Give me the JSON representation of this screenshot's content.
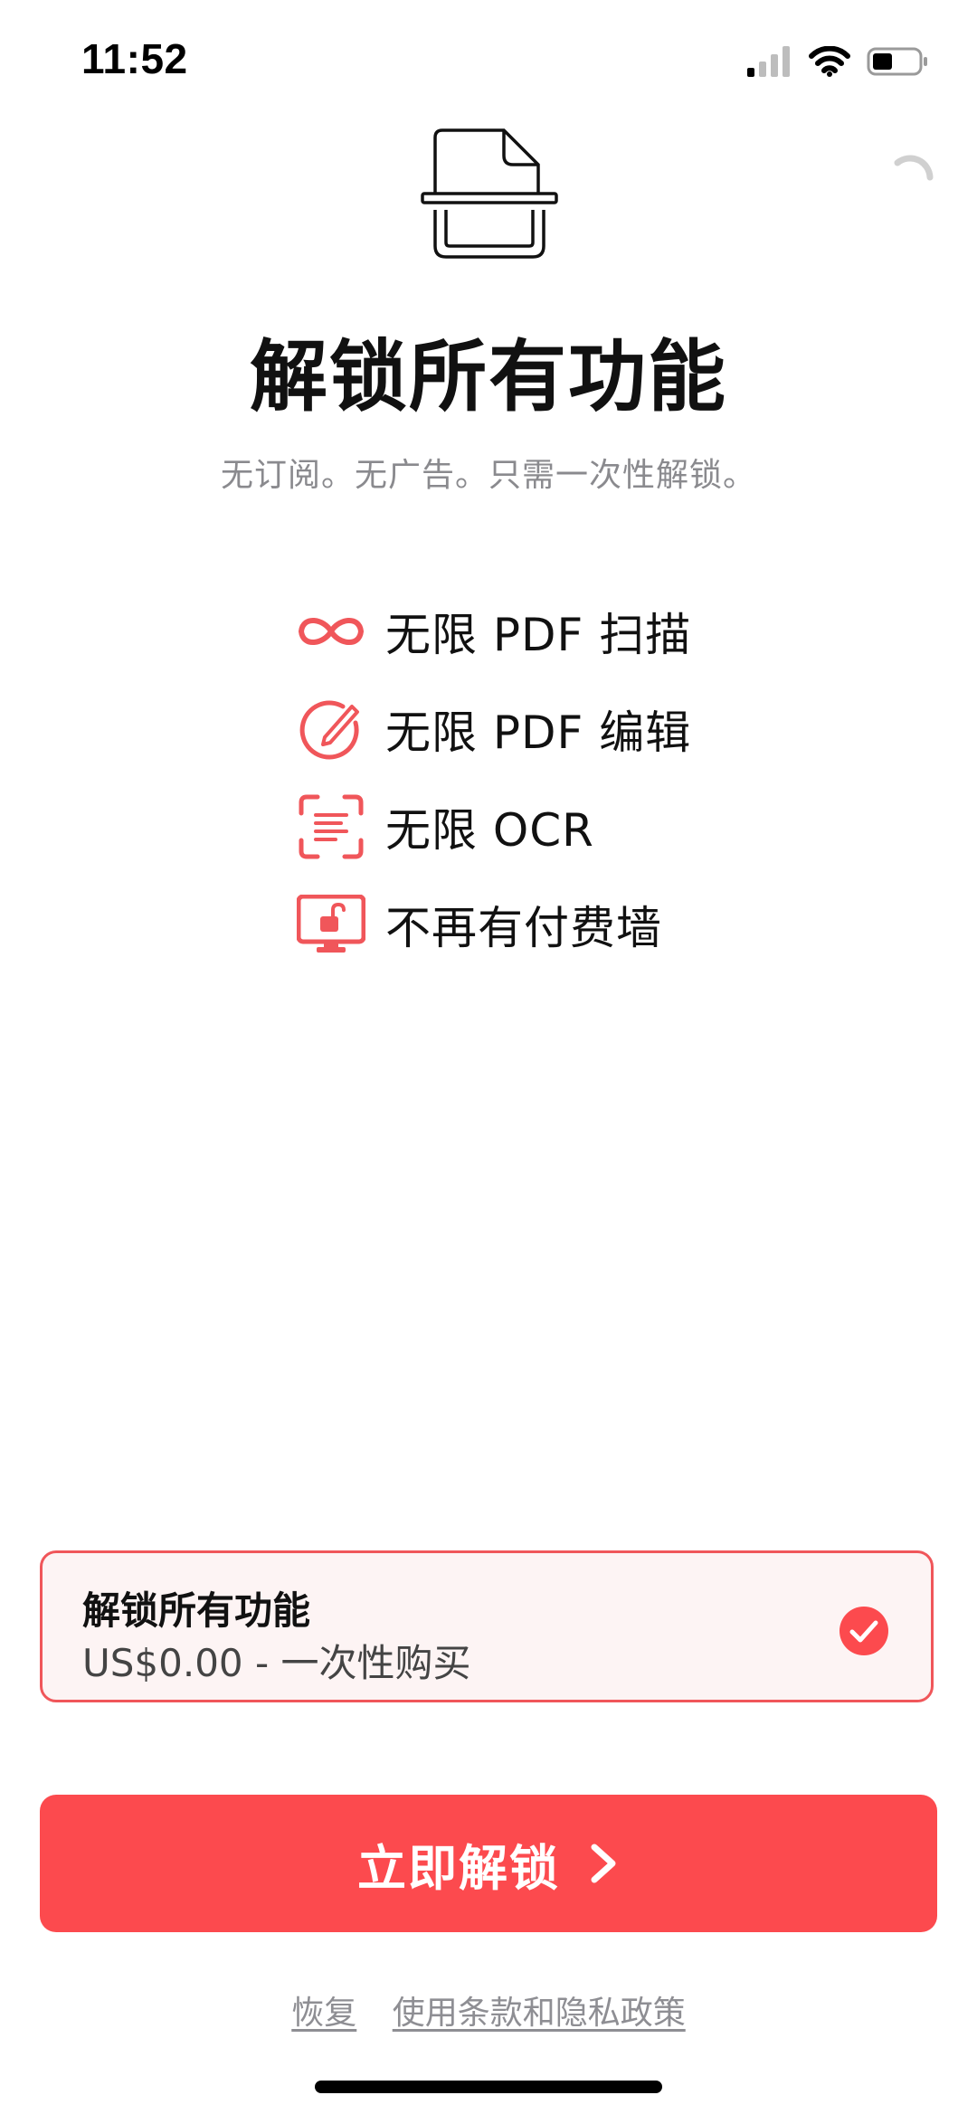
{
  "status_bar": {
    "time": "11:52",
    "icons": [
      "cellular-signal-icon",
      "wifi-icon",
      "battery-icon"
    ]
  },
  "header": {
    "logo": "document-scan-icon",
    "title": "解锁所有功能",
    "subtitle": "无订阅。无广告。只需一次性解锁。"
  },
  "features": [
    {
      "icon": "infinity-icon",
      "label": "无限 PDF 扫描"
    },
    {
      "icon": "edit-pencil-icon",
      "label": "无限 PDF 编辑"
    },
    {
      "icon": "ocr-scan-icon",
      "label": "无限 OCR"
    },
    {
      "icon": "unlocked-screen-icon",
      "label": "不再有付费墙"
    }
  ],
  "purchase_option": {
    "title": "解锁所有功能",
    "price": "US$0.00 - 一次性购买",
    "selected": true
  },
  "cta": {
    "label": "立即解锁"
  },
  "footer": {
    "restore": "恢复",
    "terms": "使用条款和隐私政策"
  },
  "colors": {
    "accent": "#FC4A4E",
    "card_border": "#F0565A",
    "card_background": "#FDF4F4",
    "subtitle_text": "#8A8A8E"
  }
}
